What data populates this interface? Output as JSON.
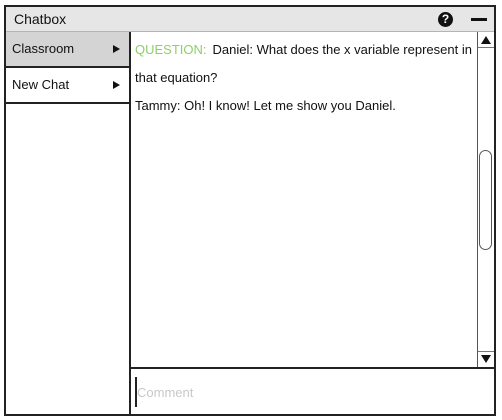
{
  "window": {
    "title": "Chatbox",
    "help_symbol": "?"
  },
  "sidebar": {
    "items": [
      {
        "label": "Classroom",
        "active": true
      },
      {
        "label": "New Chat",
        "active": false
      }
    ]
  },
  "chat": {
    "messages": [
      {
        "tag": "QUESTION:",
        "text": "Daniel: What does the x variable represent in that equation?"
      },
      {
        "tag": "",
        "text": "Tammy: Oh! I know! Let me show you Daniel."
      }
    ]
  },
  "comment": {
    "placeholder": "Comment",
    "value": ""
  },
  "colors": {
    "question_tag": "#8ecf6a",
    "active_item_bg": "#d4d4d4",
    "titlebar_bg": "#e6e6e6"
  }
}
